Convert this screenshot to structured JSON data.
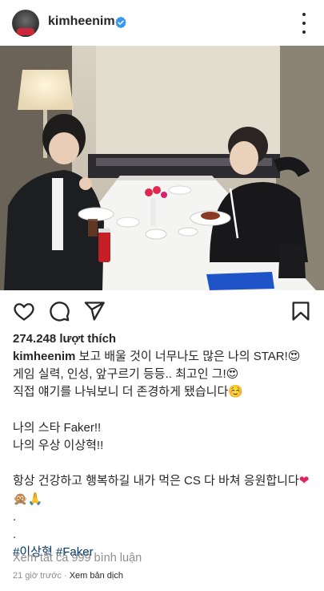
{
  "post": {
    "username": "kimheenim",
    "likes": "274.248 lượt thích",
    "caption_username": "kimheenim",
    "caption_lines": [
      " 보고 배울 것이 너무나도 많은 나의 STAR!😍",
      "게임 실력, 인성, 앞구르기 등등.. 최고인 그!😍",
      "직접 얘기를 나눠보니 더 존경하게 됐습니다☺️",
      "",
      "나의 스타 Faker!!",
      "나의 우상 이상혁!!",
      "",
      "항상 건강하고 행복하길 내가 먹은 CS 다 바쳐 응원합니다",
      "🙊🙏",
      ".",
      "."
    ],
    "heart_emoji": "❤",
    "hashtags": [
      "#이상혁",
      "#Faker"
    ],
    "comments_link": "Xem tất cả 999 bình luận",
    "time_ago": "21 giờ trước",
    "separator": "·",
    "translate_link": "Xem bản dịch"
  },
  "icons": {
    "verified": "verified-badge-icon",
    "more": "more-options-icon",
    "like": "heart-icon",
    "comment": "comment-icon",
    "share": "share-icon",
    "save": "bookmark-icon"
  },
  "colors": {
    "text": "#262626",
    "secondary": "#8e8e8e",
    "link": "#00376b",
    "verified": "#3897f0"
  }
}
